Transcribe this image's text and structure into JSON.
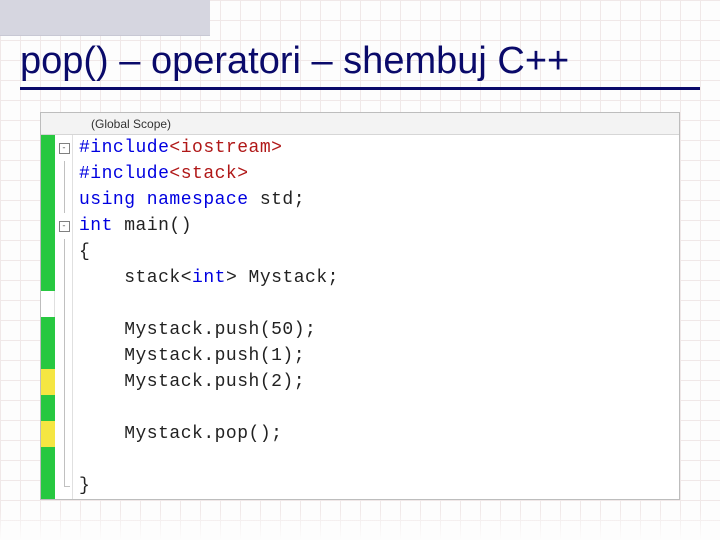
{
  "slide": {
    "title": "pop() – operatori – shembuj C++"
  },
  "editor": {
    "scope": "(Global Scope)",
    "lines": [
      {
        "cov": "green",
        "fold": "minus",
        "html": [
          [
            "kw-preproc",
            "#include"
          ],
          [
            "angle",
            "<iostream>"
          ]
        ]
      },
      {
        "cov": "green",
        "fold": "line",
        "html": [
          [
            "kw-preproc",
            "#include"
          ],
          [
            "angle",
            "<stack>"
          ]
        ]
      },
      {
        "cov": "green",
        "fold": "line",
        "html": [
          [
            "kw-blue",
            "using namespace "
          ],
          [
            "ident",
            "std"
          ],
          [
            "ident",
            ";"
          ]
        ]
      },
      {
        "cov": "green",
        "fold": "minus",
        "html": [
          [
            "kw-blue",
            "int "
          ],
          [
            "ident",
            "main()"
          ]
        ]
      },
      {
        "cov": "green",
        "fold": "line",
        "html": [
          [
            "brace",
            "{"
          ]
        ]
      },
      {
        "cov": "green",
        "fold": "line",
        "html": [
          [
            "ident",
            "    stack<"
          ],
          [
            "kw-blue",
            "int"
          ],
          [
            "ident",
            "> Mystack;"
          ]
        ]
      },
      {
        "cov": "",
        "fold": "line",
        "html": [
          [
            "ident",
            ""
          ]
        ]
      },
      {
        "cov": "green",
        "fold": "line",
        "html": [
          [
            "ident",
            "    Mystack.push(50);"
          ]
        ]
      },
      {
        "cov": "green",
        "fold": "line",
        "html": [
          [
            "ident",
            "    Mystack.push(1);"
          ]
        ]
      },
      {
        "cov": "yellow",
        "fold": "line",
        "html": [
          [
            "ident",
            "    Mystack.push(2);"
          ]
        ]
      },
      {
        "cov": "green",
        "fold": "line",
        "html": [
          [
            "ident",
            ""
          ]
        ]
      },
      {
        "cov": "yellow",
        "fold": "line",
        "html": [
          [
            "ident",
            "    Mystack.pop();"
          ]
        ]
      },
      {
        "cov": "green",
        "fold": "line",
        "html": [
          [
            "ident",
            ""
          ]
        ]
      },
      {
        "cov": "green",
        "fold": "corner",
        "html": [
          [
            "brace",
            "}"
          ]
        ]
      }
    ]
  }
}
